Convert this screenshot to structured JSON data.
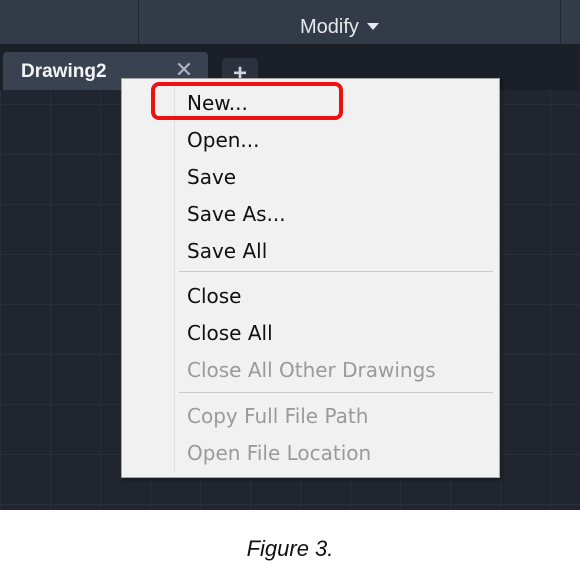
{
  "ribbon": {
    "modify_label": "Modify"
  },
  "tabs": {
    "active_label": "Drawing2",
    "close_glyph": "✕",
    "add_glyph": "+"
  },
  "context_menu": {
    "items": [
      {
        "label": "New...",
        "enabled": true,
        "highlighted": true
      },
      {
        "label": "Open...",
        "enabled": true
      },
      {
        "label": "Save",
        "enabled": true
      },
      {
        "label": "Save As...",
        "enabled": true
      },
      {
        "label": "Save All",
        "enabled": true
      },
      {
        "label": "Close",
        "enabled": true
      },
      {
        "label": "Close All",
        "enabled": true
      },
      {
        "label": "Close All Other Drawings",
        "enabled": false
      },
      {
        "label": "Copy Full File Path",
        "enabled": false
      },
      {
        "label": "Open File Location",
        "enabled": false
      }
    ]
  },
  "caption": "Figure 3.",
  "colors": {
    "highlight": "#ee1111",
    "background": "#1f232c",
    "menu_bg": "#f1f1f1"
  },
  "icons": [
    "close-icon",
    "add-tab-icon",
    "dropdown-caret-icon"
  ]
}
